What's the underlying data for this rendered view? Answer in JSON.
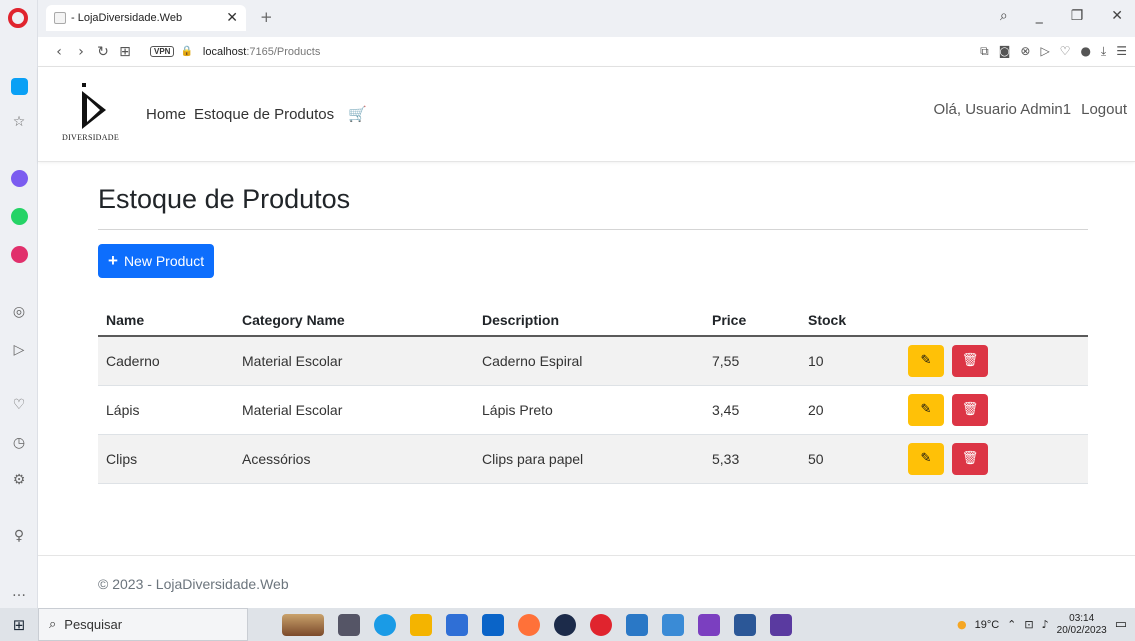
{
  "browser": {
    "tab_title": "- LojaDiversidade.Web",
    "tab_close": "✕",
    "new_tab": "+",
    "vpn": "VPN",
    "url_host": "localhost",
    "url_rest": ":7165/Products"
  },
  "header": {
    "brand_text": "DIVERSIDADE",
    "nav": [
      {
        "label": "Home"
      },
      {
        "label": "Estoque de Produtos"
      }
    ],
    "greeting": "Olá, Usuario Admin1",
    "logout": "Logout"
  },
  "main": {
    "title": "Estoque de Produtos",
    "new_button": "New Product",
    "columns": [
      "Name",
      "Category Name",
      "Description",
      "Price",
      "Stock"
    ],
    "rows": [
      {
        "name": "Caderno",
        "category": "Material Escolar",
        "description": "Caderno Espiral",
        "price": "7,55",
        "stock": "10"
      },
      {
        "name": "Lápis",
        "category": "Material Escolar",
        "description": "Lápis Preto",
        "price": "3,45",
        "stock": "20"
      },
      {
        "name": "Clips",
        "category": "Acessórios",
        "description": "Clips para papel",
        "price": "5,33",
        "stock": "50"
      }
    ]
  },
  "footer": {
    "text": "© 2023 - LojaDiversidade.Web"
  },
  "taskbar": {
    "search_placeholder": "Pesquisar",
    "temperature": "19°C",
    "time": "03:14",
    "date": "20/02/2023"
  },
  "colors": {
    "primary": "#0d6efd",
    "warning": "#ffc107",
    "danger": "#dc3545",
    "opera_red": "#e0242e"
  }
}
